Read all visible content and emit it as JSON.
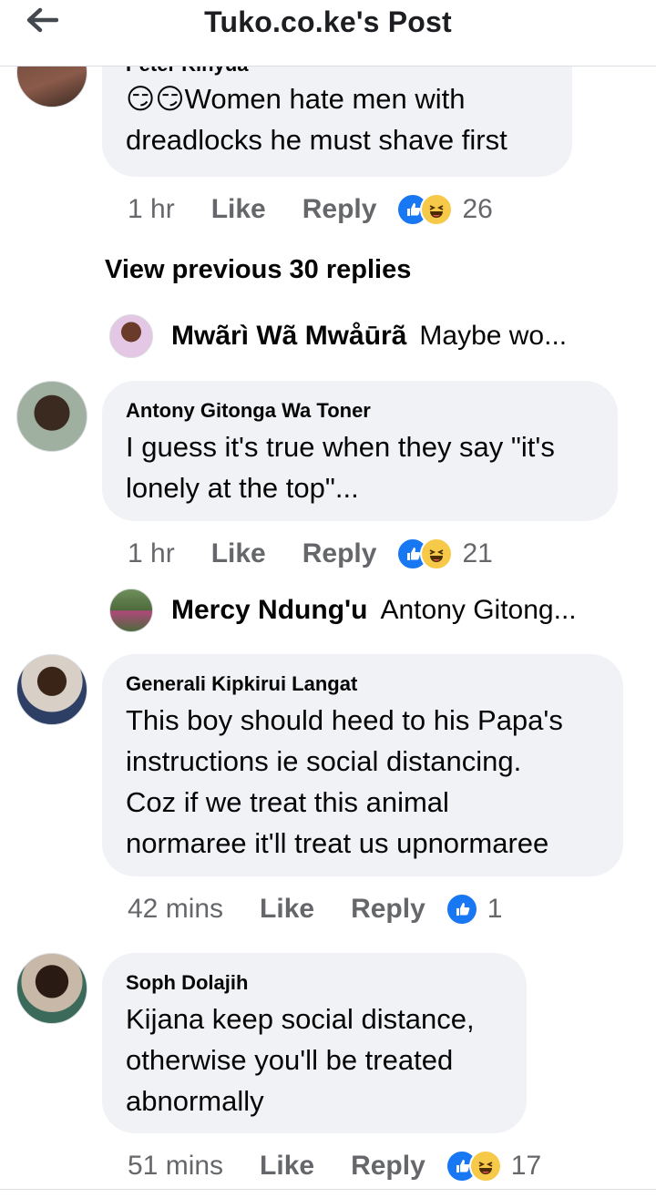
{
  "header": {
    "title": "Tuko.co.ke's Post"
  },
  "comments": [
    {
      "author": "Peter Kinyua",
      "lines": [
        "😏😏Women hate men with",
        "dreadlocks he must shave first"
      ],
      "time": "1 hr",
      "like": "Like",
      "reply": "Reply",
      "reaction_count": "26"
    },
    {
      "author": "Antony Gitonga Wa Toner",
      "lines": [
        "I guess it's true when they say \"it's",
        "lonely at the top\"..."
      ],
      "time": "1 hr",
      "like": "Like",
      "reply": "Reply",
      "reaction_count": "21"
    },
    {
      "author": "Generali Kipkirui Langat",
      "lines": [
        "This boy should heed to his Papa's",
        "instructions ie social distancing.",
        "Coz if we treat this animal",
        "normaree it'll treat us upnormaree"
      ],
      "time": "42 mins",
      "like": "Like",
      "reply": "Reply",
      "reaction_count": "1"
    },
    {
      "author": "Soph Dolajih",
      "lines": [
        "Kijana keep social distance,",
        "otherwise you'll be treated",
        "abnormally"
      ],
      "time": "51 mins",
      "like": "Like",
      "reply": "Reply",
      "reaction_count": "17"
    }
  ],
  "view_previous": "View previous 30 replies",
  "replies": [
    {
      "name": "Mwãrì Wã Mwåūrã",
      "snippet": "Maybe wo..."
    },
    {
      "name": "Mercy Ndung'u",
      "snippet": "Antony Gitong..."
    }
  ],
  "colors": {
    "like_blue": "#1877f2",
    "bubble": "#f0f2f5",
    "meta_gray": "#65676b"
  },
  "icons": [
    "back-arrow-icon",
    "like-reaction-icon",
    "haha-reaction-icon"
  ]
}
